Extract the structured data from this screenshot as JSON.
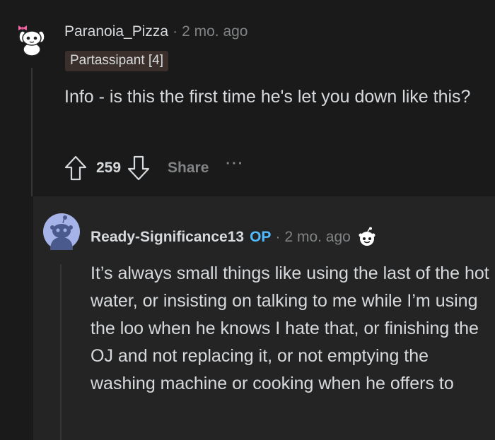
{
  "parent_comment": {
    "author": "Paranoia_Pizza",
    "separator": "·",
    "time": "2 mo. ago",
    "flair": "Partassipant [4]",
    "body": "Info - is this the first time he's let you down like this?",
    "score": "259",
    "share_label": "Share",
    "more_label": "···"
  },
  "reply_comment": {
    "author": "Ready-Significance13",
    "op_badge": "OP",
    "separator": "·",
    "time": "2 mo. ago",
    "body": "It’s always small things like using the last of the hot water, or insisting on talking to me while I’m using the loo when he knows I hate that, or finishing the OJ and not replacing it, or not emptying the washing machine or cooking when he offers to"
  },
  "colors": {
    "background": "#1a1a1b",
    "reply_background": "#242425",
    "text": "#d7dadc",
    "muted": "#818384",
    "op_badge": "#4fbcff",
    "flair_background": "#3a2f2a",
    "thread_line": "#343536"
  }
}
